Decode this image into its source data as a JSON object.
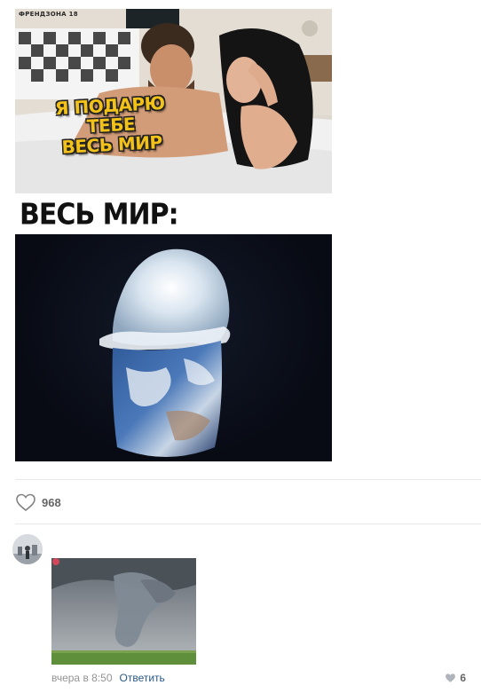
{
  "post": {
    "image": {
      "watermark": "ФРЕНДЗОНА 18",
      "caption_top_line1": "Я ПОДАРЮ ТЕБЕ",
      "caption_top_line2": "ВЕСЬ МИР",
      "caption_middle": "ВЕСЬ МИР:"
    },
    "likes": {
      "icon": "heart-icon",
      "count": "968"
    }
  },
  "comment": {
    "avatar_icon": "avatar",
    "timestamp": "вчера в 8:50",
    "reply_label": "Ответить",
    "likes": {
      "icon": "heart-icon",
      "count": "6"
    }
  },
  "colors": {
    "link": "#2a5885",
    "meta_text": "#939393",
    "divider": "#e7e8ec",
    "caption_yellow": "#f2c21a"
  }
}
